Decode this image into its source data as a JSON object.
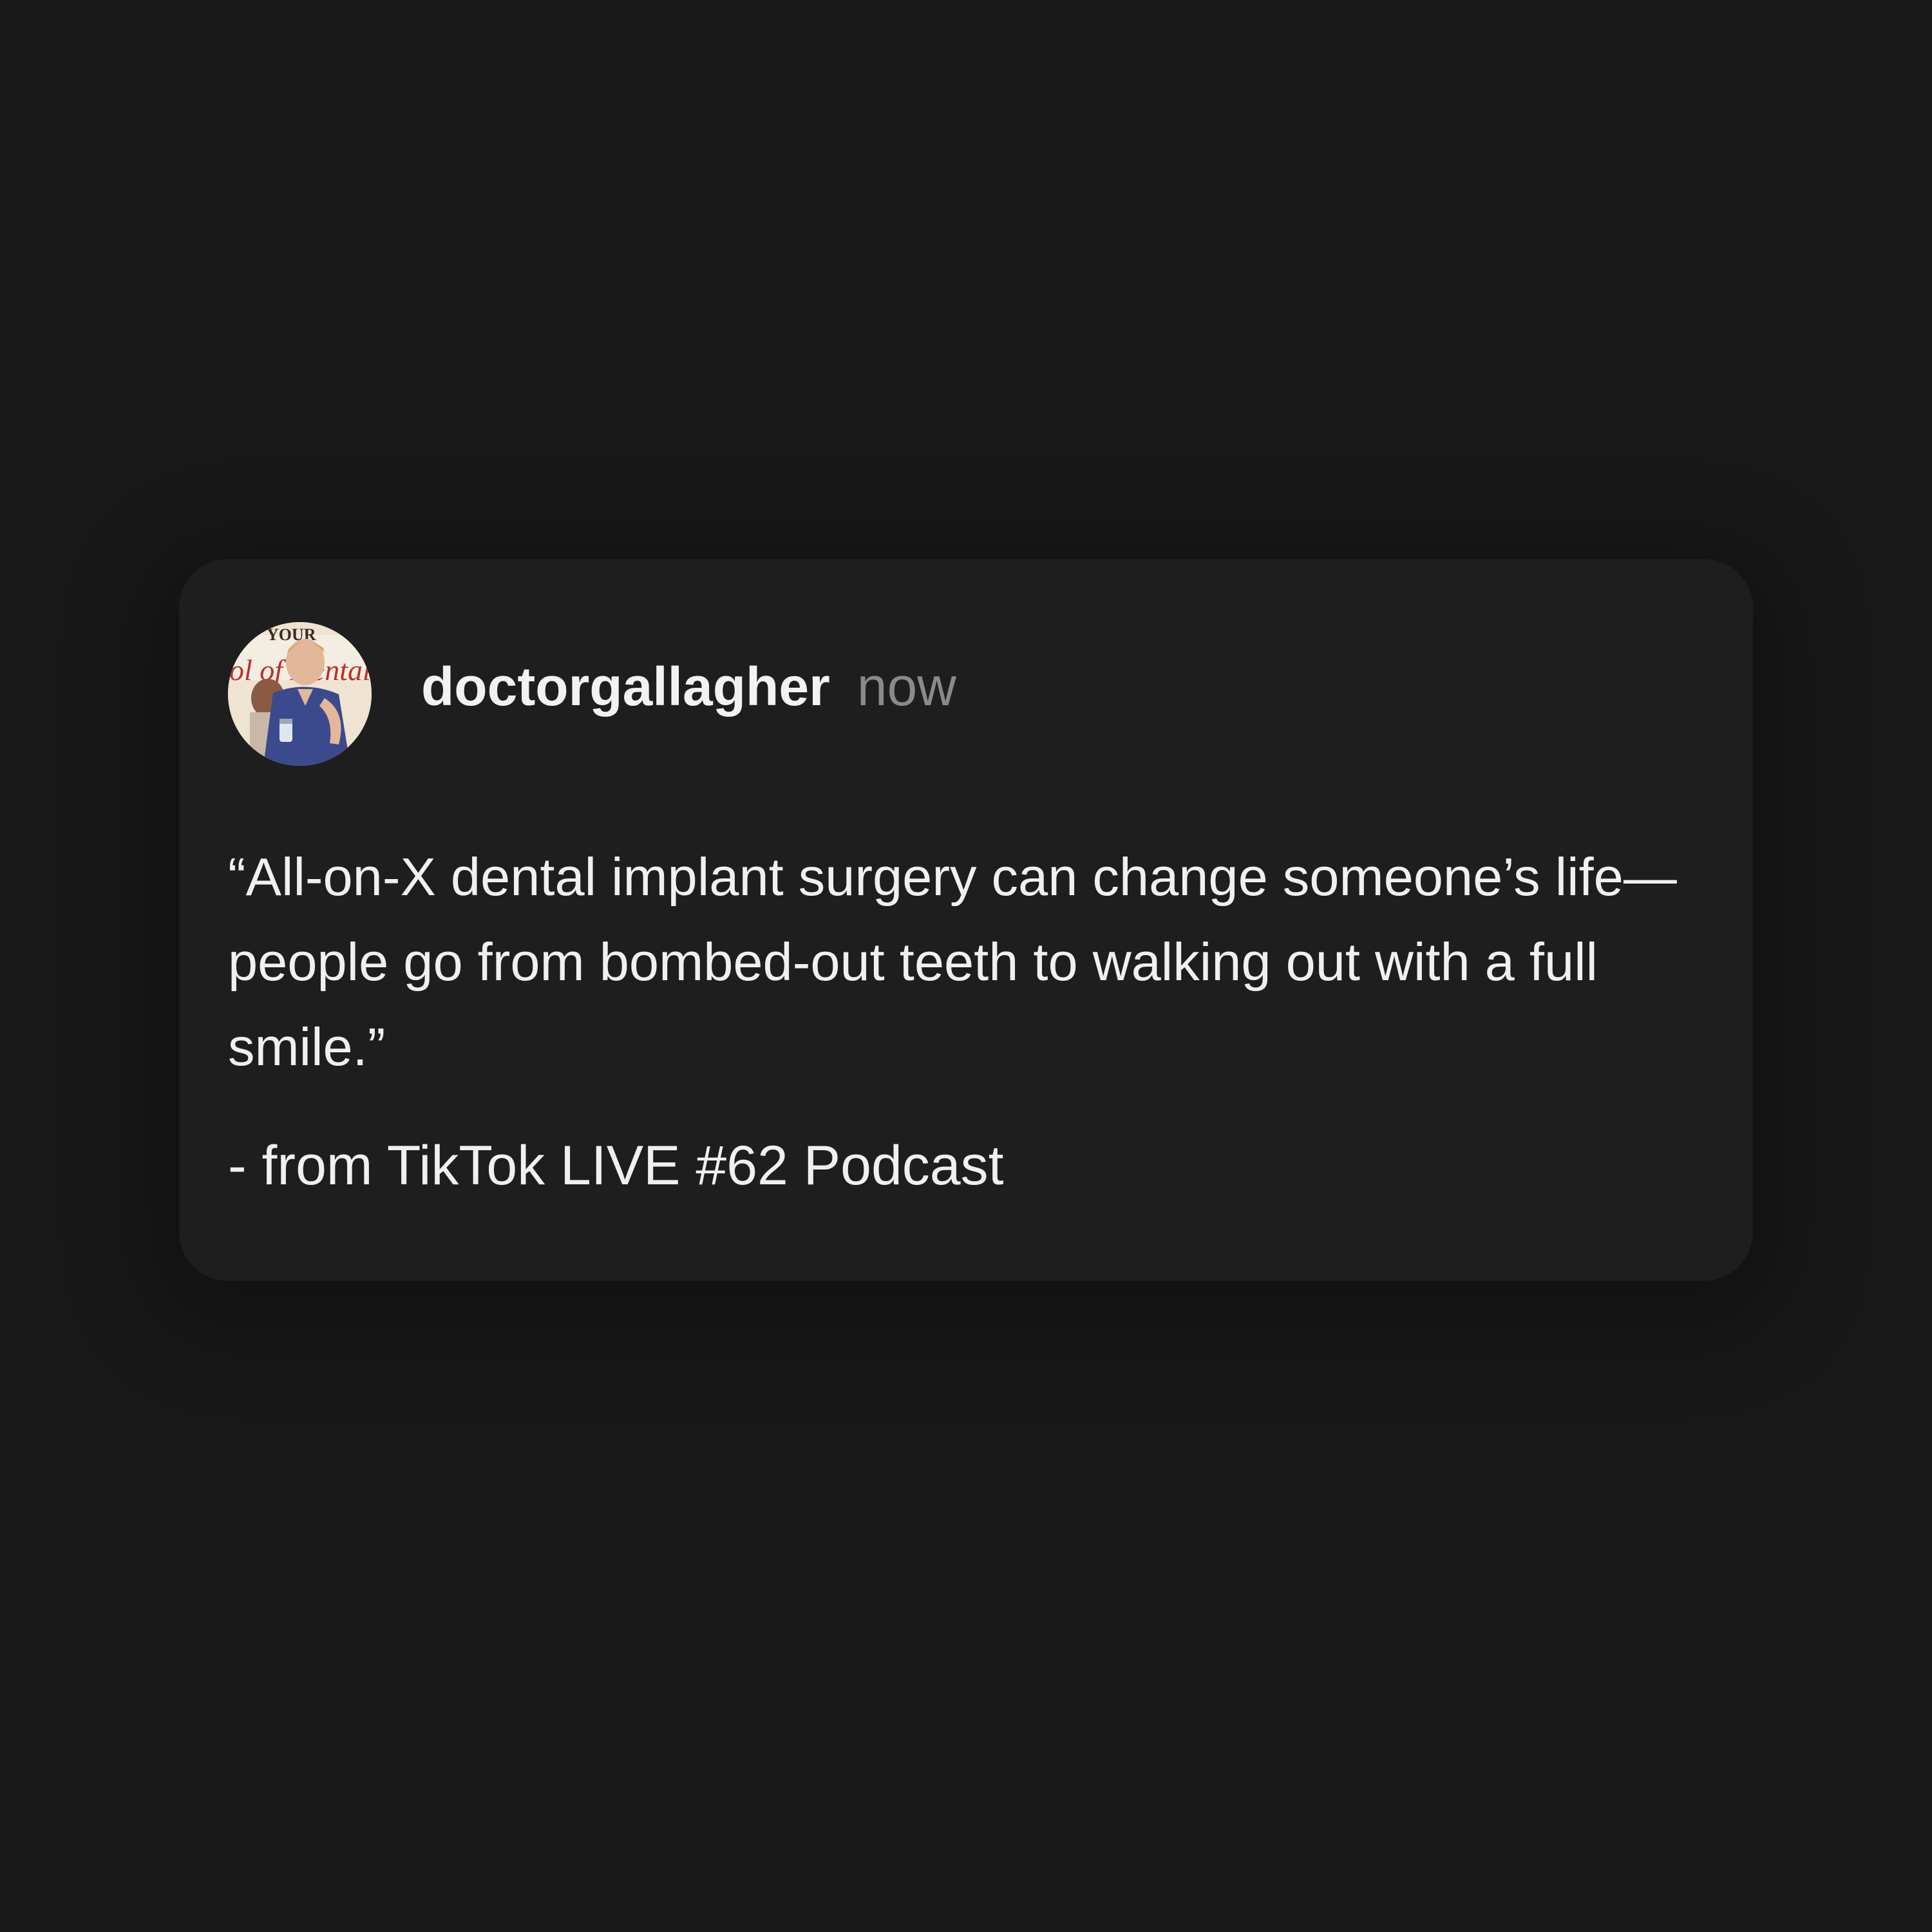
{
  "post": {
    "username": "doctorgallagher",
    "timestamp": "now",
    "quote": "“All-on-X dental implant surgery can change someone’s life—people go from bombed-out teeth to walking out with a full smile.”",
    "source": "- from TikTok LIVE #62 Podcast"
  },
  "avatar": {
    "description_icon": "profile-photo",
    "sign_text": "ol of Dental"
  },
  "colors": {
    "page_background": "#191919",
    "card_background": "#1e1e1e",
    "primary_text": "#f0f0f0",
    "secondary_text": "#8a8a8a"
  }
}
